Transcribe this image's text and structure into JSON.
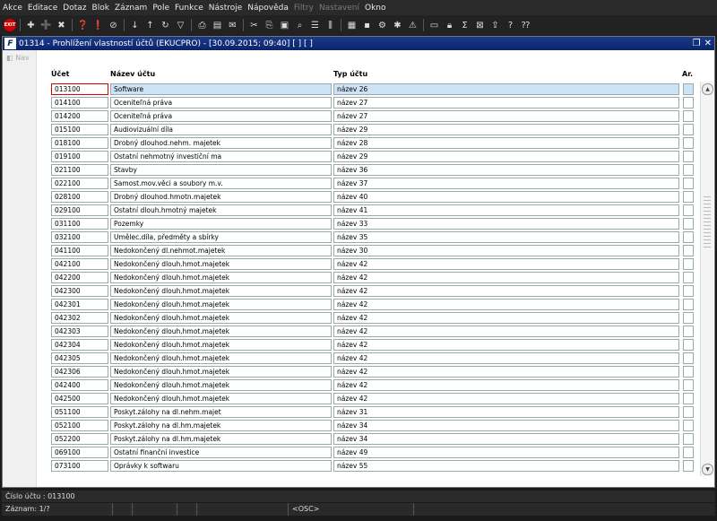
{
  "menu": [
    "Akce",
    "Editace",
    "Dotaz",
    "Blok",
    "Záznam",
    "Pole",
    "Funkce",
    "Nástroje",
    "Nápověda",
    "Filtry",
    "Nastavení",
    "Okno"
  ],
  "menu_disabled": [
    "Filtry",
    "Nastavení"
  ],
  "window": {
    "title": "01314 - Prohlížení vlastností účtů (EKUCPRO) - [30.09.2015; 09:40] [ ] [ ]",
    "icon_letter": "F"
  },
  "nav": {
    "label": "Nav"
  },
  "columns": {
    "ucet": "Účet",
    "nazev": "Název účtu",
    "typ": "Typ účtu",
    "ar": "Ar."
  },
  "rows": [
    {
      "ucet": "013100",
      "nazev": "Software",
      "typ": "název 26"
    },
    {
      "ucet": "014100",
      "nazev": "Oceniteľná práva",
      "typ": "název 27"
    },
    {
      "ucet": "014200",
      "nazev": "Oceniteľná práva",
      "typ": "název 27"
    },
    {
      "ucet": "015100",
      "nazev": "Audiovizuální díla",
      "typ": "název 29"
    },
    {
      "ucet": "018100",
      "nazev": "Drobný dlouhod.nehm. majetek",
      "typ": "název 28"
    },
    {
      "ucet": "019100",
      "nazev": "Ostatní nehmotný investiční ma",
      "typ": "název 29"
    },
    {
      "ucet": "021100",
      "nazev": "Stavby",
      "typ": "název 36"
    },
    {
      "ucet": "022100",
      "nazev": "Samost.mov.věci a soubory m.v.",
      "typ": "název 37"
    },
    {
      "ucet": "028100",
      "nazev": "Drobný dlouhod.hmotn.majetek",
      "typ": "název 40"
    },
    {
      "ucet": "029100",
      "nazev": "Ostatní dlouh.hmotný majetek",
      "typ": "název 41"
    },
    {
      "ucet": "031100",
      "nazev": "Pozemky",
      "typ": "název 33"
    },
    {
      "ucet": "032100",
      "nazev": "Umělec.díla, předměty a sbírky",
      "typ": "název 35"
    },
    {
      "ucet": "041100",
      "nazev": "Nedokončený dl.nehmot.majetek",
      "typ": "název 30"
    },
    {
      "ucet": "042100",
      "nazev": "Nedokončený dlouh.hmot.majetek",
      "typ": "název 42"
    },
    {
      "ucet": "042200",
      "nazev": "Nedokončený dlouh.hmot.majetek",
      "typ": "název 42"
    },
    {
      "ucet": "042300",
      "nazev": "Nedokončený dlouh.hmot.majetek",
      "typ": "název 42"
    },
    {
      "ucet": "042301",
      "nazev": "Nedokončený dlouh.hmot.majetek",
      "typ": "název 42"
    },
    {
      "ucet": "042302",
      "nazev": "Nedokončený dlouh.hmot.majetek",
      "typ": "název 42"
    },
    {
      "ucet": "042303",
      "nazev": "Nedokončený dlouh.hmot.majetek",
      "typ": "název 42"
    },
    {
      "ucet": "042304",
      "nazev": "Nedokončený dlouh.hmot.majetek",
      "typ": "název 42"
    },
    {
      "ucet": "042305",
      "nazev": "Nedokončený dlouh.hmot.majetek",
      "typ": "název 42"
    },
    {
      "ucet": "042306",
      "nazev": "Nedokončený dlouh.hmot.majetek",
      "typ": "název 42"
    },
    {
      "ucet": "042400",
      "nazev": "Nedokončený dlouh.hmot.majetek",
      "typ": "název 42"
    },
    {
      "ucet": "042500",
      "nazev": "Nedokončený dlouh.hmot.majetek",
      "typ": "název 42"
    },
    {
      "ucet": "051100",
      "nazev": "Poskyt.zálohy na dl.nehm.majet",
      "typ": "název 31"
    },
    {
      "ucet": "052100",
      "nazev": "Poskyt.zálohy na dl.hm.majetek",
      "typ": "název 34"
    },
    {
      "ucet": "052200",
      "nazev": "Poskyt.zálohy na dl.hm.majetek",
      "typ": "název 34"
    },
    {
      "ucet": "069100",
      "nazev": "Ostatní finanční investice",
      "typ": "název 49"
    },
    {
      "ucet": "073100",
      "nazev": "Oprávky k softwaru",
      "typ": "název 55"
    }
  ],
  "selected_row": 0,
  "status": {
    "field": "Číslo účtu : 013100",
    "record": "Záznam: 1/?",
    "mode": "<OSC>"
  }
}
